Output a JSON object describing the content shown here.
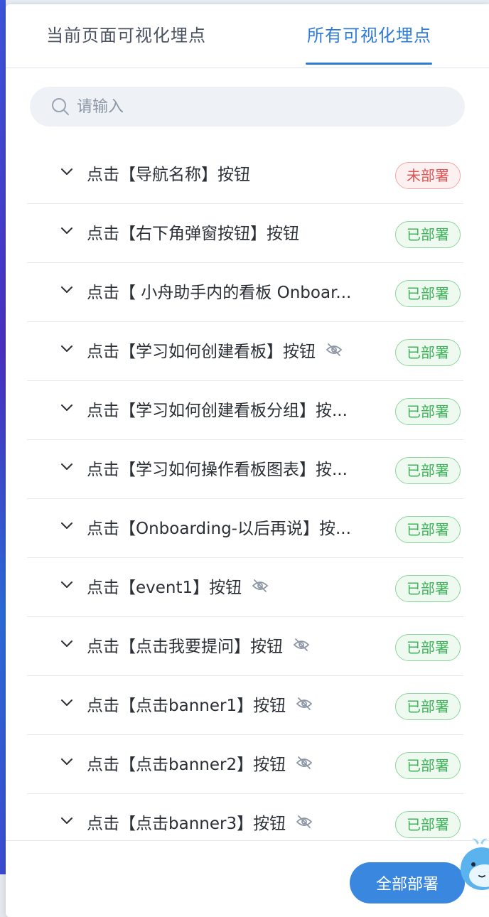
{
  "tabs": [
    {
      "label": "当前页面可视化埋点",
      "active": false
    },
    {
      "label": "所有可视化埋点",
      "active": true
    }
  ],
  "search": {
    "placeholder": "请输入"
  },
  "status_labels": {
    "deployed": "已部署",
    "undeployed": "未部署"
  },
  "colors": {
    "accent": "#2f7bd8",
    "deployed": "#3fb35a",
    "undeployed": "#e05454"
  },
  "items": [
    {
      "label": "点击【导航名称】按钮",
      "hidden": false,
      "status": "未部署"
    },
    {
      "label": "点击【右下角弹窗按钮】按钮",
      "hidden": false,
      "status": "已部署"
    },
    {
      "label": "点击【 小舟助手内的看板 Onboar...",
      "hidden": false,
      "status": "已部署"
    },
    {
      "label": "点击【学习如何创建看板】按钮",
      "hidden": true,
      "status": "已部署"
    },
    {
      "label": "点击【学习如何创建看板分组】按...",
      "hidden": false,
      "status": "已部署"
    },
    {
      "label": "点击【学习如何操作看板图表】按...",
      "hidden": false,
      "status": "已部署"
    },
    {
      "label": "点击【Onboarding-以后再说】按...",
      "hidden": false,
      "status": "已部署"
    },
    {
      "label": "点击【event1】按钮",
      "hidden": true,
      "status": "已部署"
    },
    {
      "label": "点击【点击我要提问】按钮",
      "hidden": true,
      "status": "已部署"
    },
    {
      "label": "点击【点击banner1】按钮",
      "hidden": true,
      "status": "已部署"
    },
    {
      "label": "点击【点击banner2】按钮",
      "hidden": true,
      "status": "已部署"
    },
    {
      "label": "点击【点击banner3】按钮",
      "hidden": true,
      "status": "已部署"
    }
  ],
  "footer": {
    "deploy_all_label": "全部部署"
  }
}
